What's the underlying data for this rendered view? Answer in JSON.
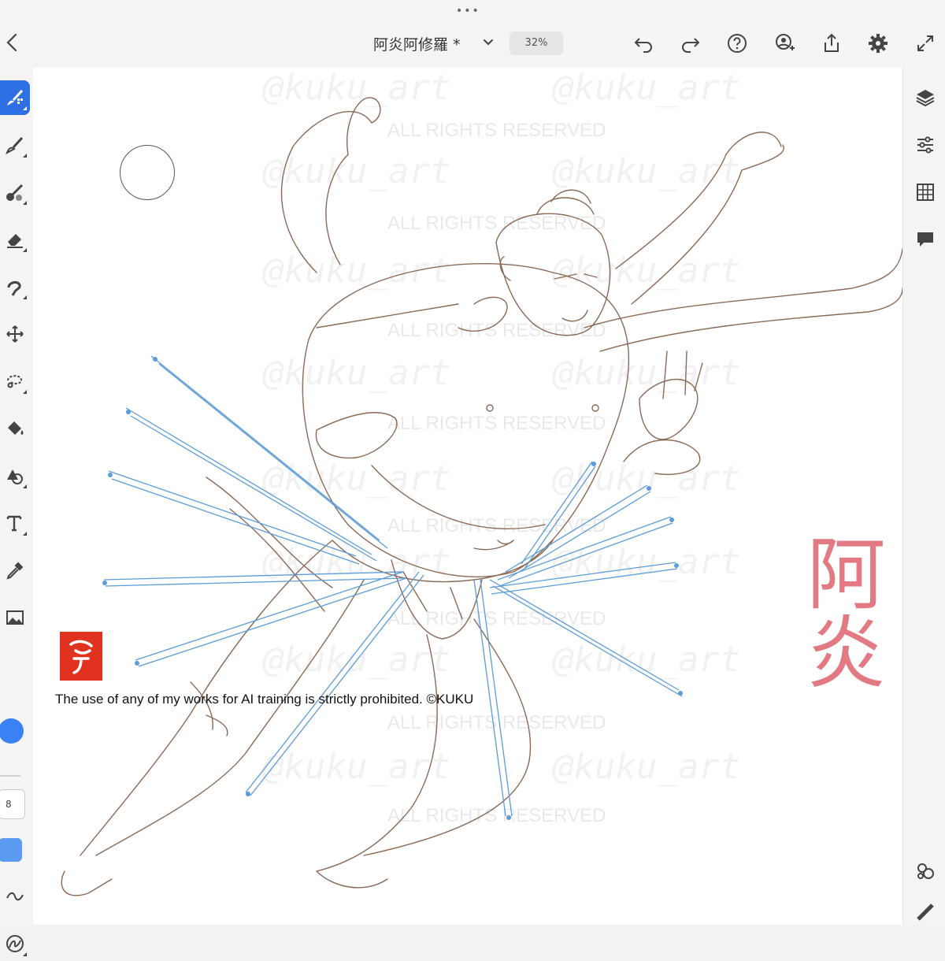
{
  "header": {
    "grip_dots": "•••",
    "doc_title": "阿炎阿修羅 *",
    "zoom_level": "32%"
  },
  "tools": {
    "brush_size": "8"
  },
  "canvas": {
    "watermark_handle": "@kuku_art",
    "watermark_rights": "ALL RIGHTS RESERVED",
    "notice": "The use of any of my works for AI training is strictly prohibited. ©KUKU",
    "seal_text": "穹",
    "calligraphy": "阿炎"
  },
  "colors": {
    "accent": "#2f6fe4",
    "brush_color": "#3b82f6",
    "guide_lines": "#5b9bd8",
    "sketch_lines": "#8a6a55"
  },
  "icons": [
    "back-chevron-icon",
    "undo-icon",
    "redo-icon",
    "help-icon",
    "invite-user-icon",
    "share-icon",
    "settings-icon",
    "fullscreen-icon",
    "pixel-brush-icon",
    "live-brush-icon",
    "fill-brush-icon",
    "eraser-icon",
    "smudge-icon",
    "move-icon",
    "lasso-icon",
    "paint-bucket-icon",
    "shapes-icon",
    "text-icon",
    "eyedropper-icon",
    "image-icon",
    "smoothing-icon",
    "pressure-icon",
    "layers-icon",
    "adjustments-icon",
    "grid-icon",
    "comments-icon",
    "touch-shortcut-icon",
    "ruler-icon"
  ]
}
